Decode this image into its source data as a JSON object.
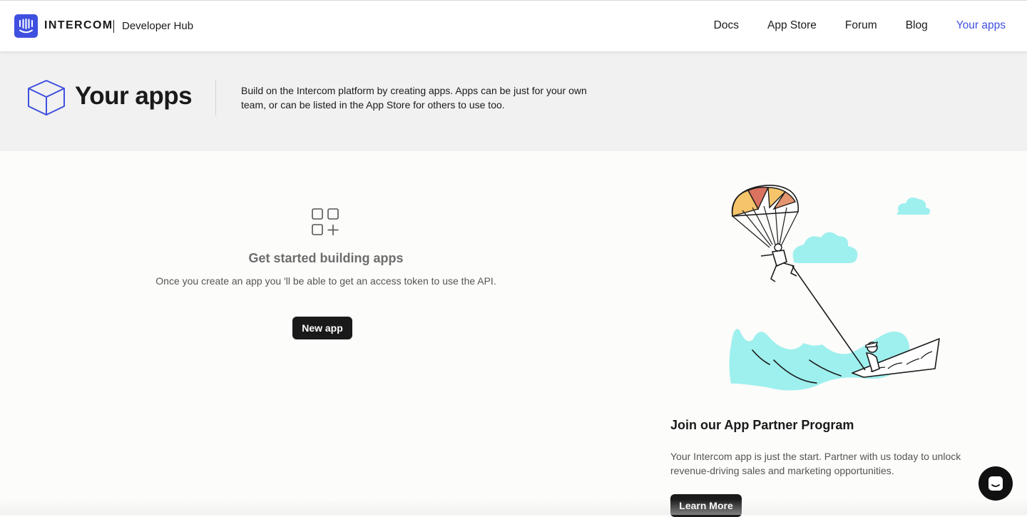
{
  "header": {
    "brand": "INTERCOM",
    "subtitle": "Developer Hub",
    "nav": [
      "Docs",
      "App Store",
      "Forum",
      "Blog",
      "Your apps"
    ],
    "active_nav": "Your apps"
  },
  "hero": {
    "title": "Your apps",
    "description": "Build on the Intercom platform by creating apps. Apps can be just for your own team, or can be listed in the App Store for others to use too."
  },
  "empty_state": {
    "icon": "apps-grid-plus-icon",
    "title": "Get started building apps",
    "description": "Once you create an app you 'll be able to get an access token to use the API.",
    "button": "New app"
  },
  "partner": {
    "title": "Join our App Partner Program",
    "description": "Your Intercom app is just the start. Partner with us today to unlock revenue-driving sales and marketing opportunities.",
    "button": "Learn More"
  },
  "colors": {
    "accent": "#3f50e0",
    "hero_bg": "#f1f1f1",
    "button": "#1a1a1a",
    "illustration_water": "#9ef0ee"
  }
}
